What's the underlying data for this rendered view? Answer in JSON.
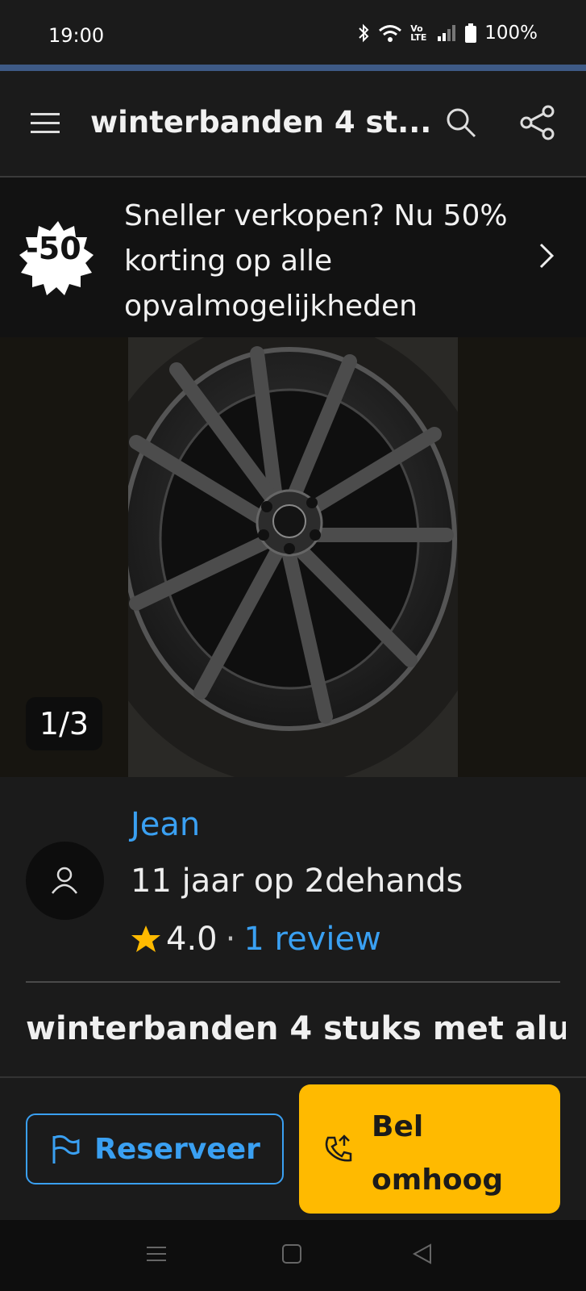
{
  "status": {
    "time": "19:00",
    "battery": "100%",
    "network_label": "Vo LTE"
  },
  "appbar": {
    "title": "winterbanden  4 st...",
    "menu_icon": "menu-icon",
    "search_icon": "search-icon",
    "share_icon": "share-icon"
  },
  "promo": {
    "badge": "-50",
    "text": "Sneller verkopen? Nu 50% korting op alle opvalmogelijkheden",
    "chevron_icon": "chevron-right-icon"
  },
  "gallery": {
    "counter": "1/3"
  },
  "seller": {
    "name": "Jean",
    "since": "11 jaar op 2dehands",
    "rating": "4.0",
    "separator": "·",
    "reviews": "1 review"
  },
  "ad": {
    "title": "winterbanden  4 stuks met alu"
  },
  "actions": {
    "reserve_label": "Reserveer",
    "call_label_line1": "Bel",
    "call_label_line2": "omhoog"
  },
  "colors": {
    "accent_blue": "#3aa0f2",
    "call_yellow": "#ffba00",
    "star_yellow": "#ffba00"
  }
}
